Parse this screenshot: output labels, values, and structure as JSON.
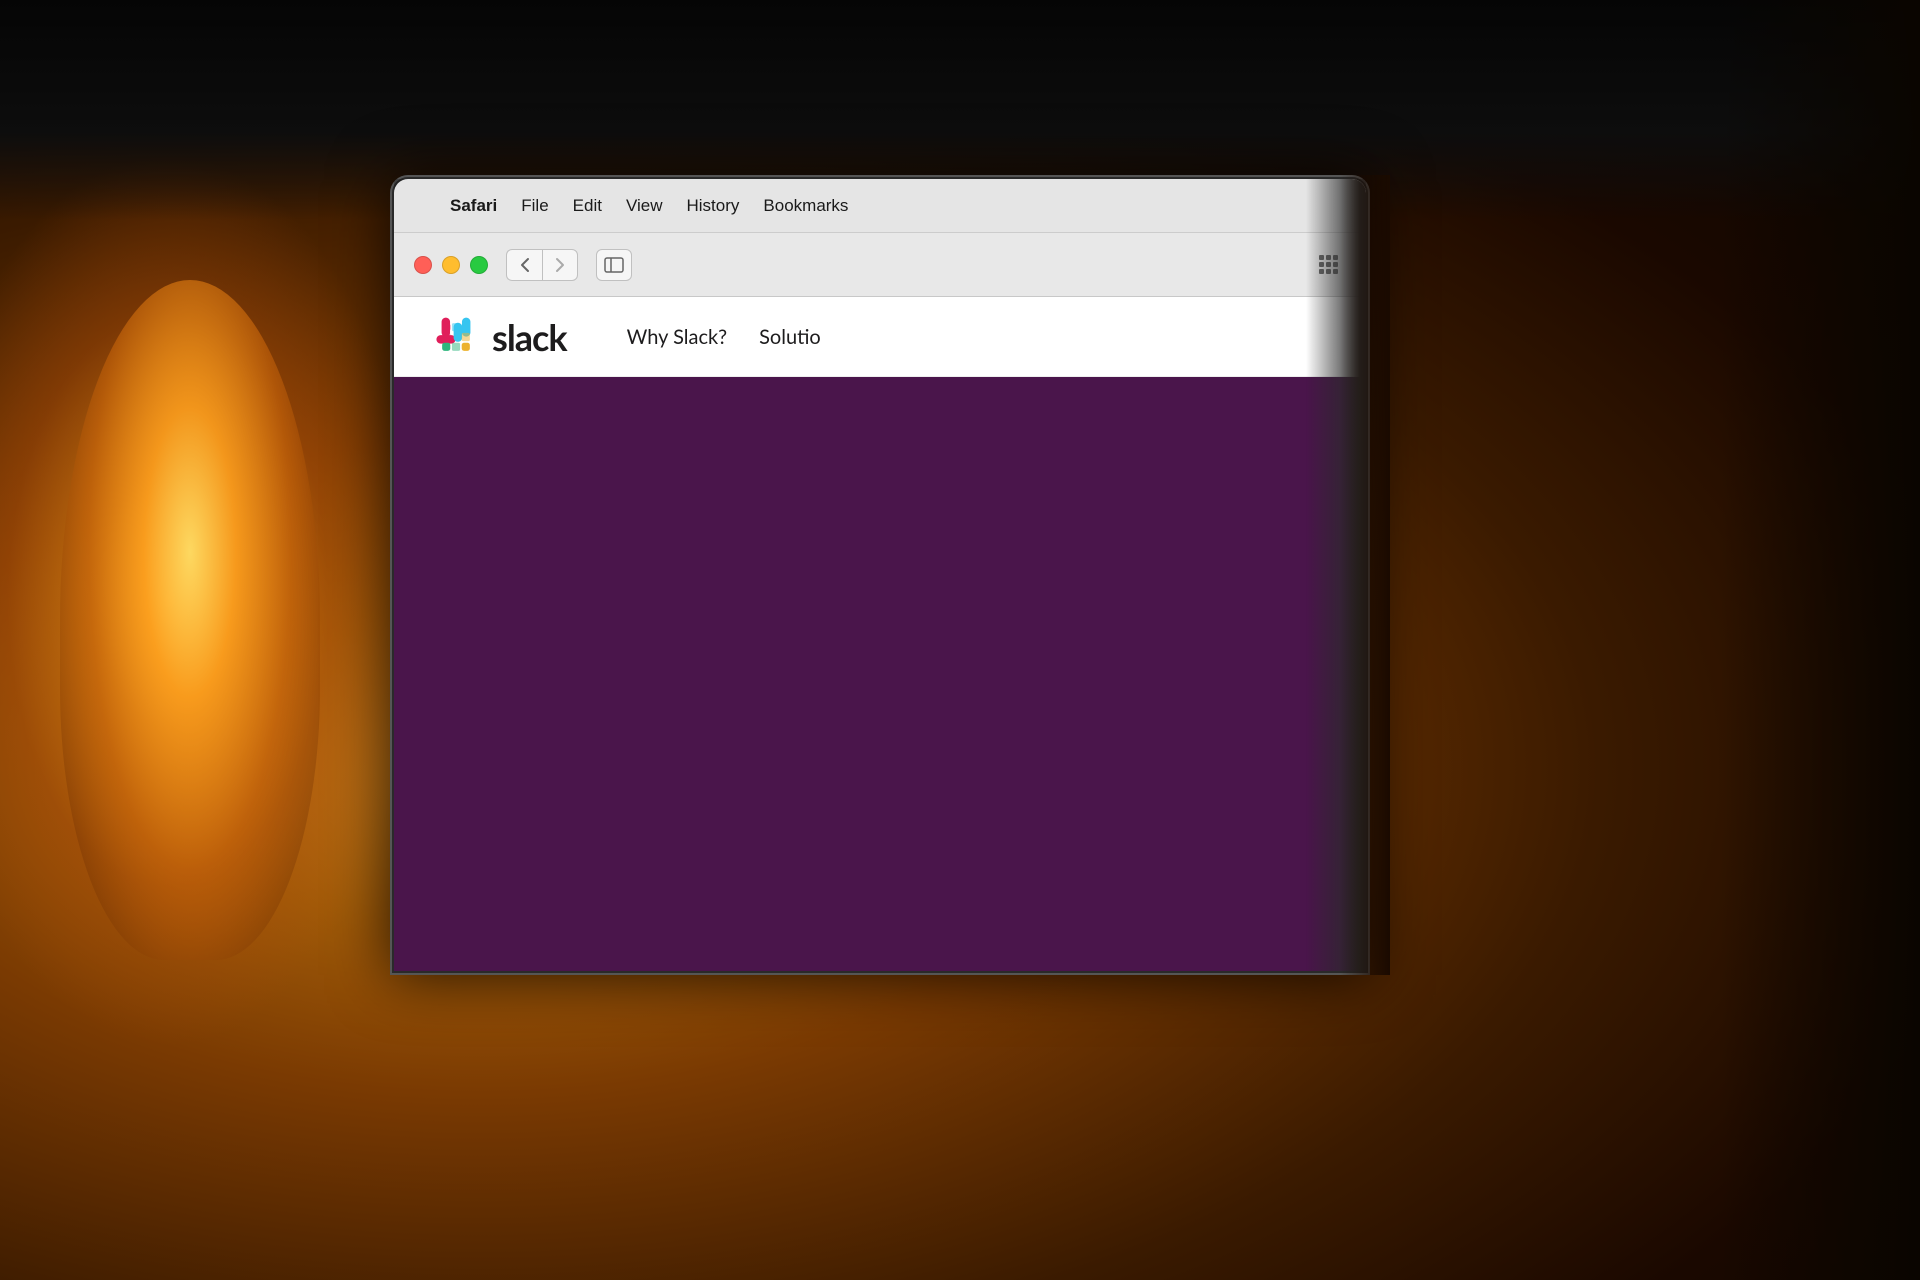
{
  "background": {
    "color": "#1a0a00"
  },
  "macos": {
    "menubar": {
      "apple_icon": "",
      "items": [
        {
          "label": "Safari",
          "bold": true
        },
        {
          "label": "File",
          "bold": false
        },
        {
          "label": "Edit",
          "bold": false
        },
        {
          "label": "View",
          "bold": false
        },
        {
          "label": "History",
          "bold": false
        },
        {
          "label": "Bookmarks",
          "bold": false
        }
      ]
    }
  },
  "safari": {
    "toolbar": {
      "back_label": "‹",
      "forward_label": "›",
      "sidebar_icon": "⊡"
    }
  },
  "slack": {
    "logo_text": "slack",
    "nav_items": [
      {
        "label": "Why Slack?"
      },
      {
        "label": "Solutio"
      }
    ],
    "hero_bg": "#4a154b"
  }
}
